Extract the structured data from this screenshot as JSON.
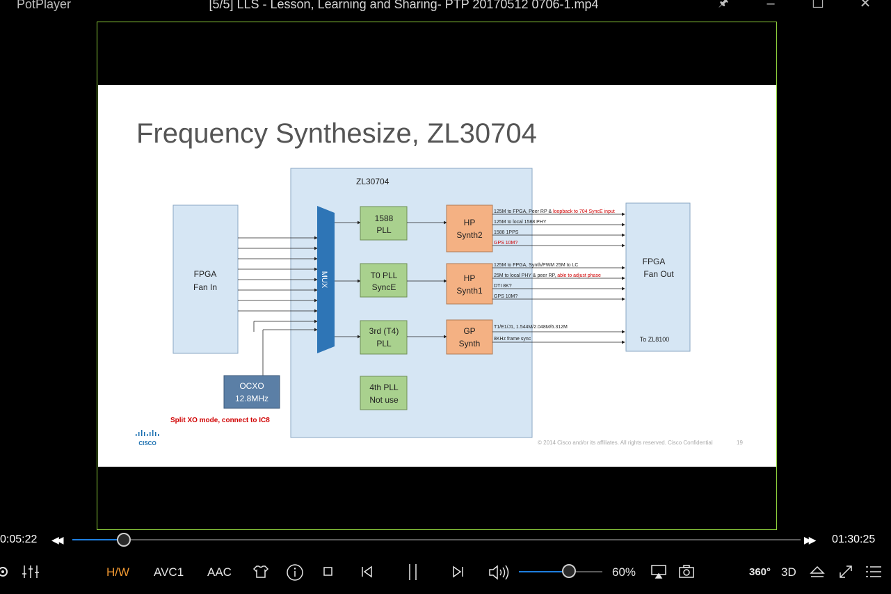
{
  "window": {
    "app_name": "PotPlayer",
    "title": "[5/5] LLS - Lesson, Learning and Sharing- PTP 20170512 0706-1.mp4"
  },
  "slide": {
    "title": "Frequency Synthesize, ZL30704",
    "chip_label": "ZL30704",
    "fpga_in": [
      "FPGA",
      "Fan In"
    ],
    "fpga_out": [
      "FPGA",
      "Fan Out"
    ],
    "fpga_out_note": "To ZL8100",
    "mux": "MUX",
    "ocxo": [
      "OCXO",
      "12.8MHz"
    ],
    "split_note": "Split XO mode, connect to IC8",
    "plls": [
      {
        "line1": "1588",
        "line2": "PLL"
      },
      {
        "line1": "T0 PLL",
        "line2": "SyncE"
      },
      {
        "line1": "3rd (T4)",
        "line2": "PLL"
      },
      {
        "line1": "4th PLL",
        "line2": "Not use"
      }
    ],
    "synths": [
      {
        "line1": "HP",
        "line2": "Synth2"
      },
      {
        "line1": "HP",
        "line2": "Synth1"
      },
      {
        "line1": "GP",
        "line2": "Synth"
      }
    ],
    "outputs": [
      {
        "text": "125M to FPGA, Peer RP & ",
        "red": "loopback to 704 SyncE input"
      },
      {
        "text": "125M to local 1588 PHY",
        "red": ""
      },
      {
        "text": "1588 1PPS",
        "red": ""
      },
      {
        "text": "",
        "red": "GPS 10M?"
      },
      {
        "text": "125M to FPGA, Synth/PWM 25M to LC",
        "red": ""
      },
      {
        "text": "25M to local PHY & peer RP, ",
        "red": "able to adjust phase"
      },
      {
        "text": "DTI 8K?",
        "red": ""
      },
      {
        "text": "GPS 10M?",
        "red": ""
      },
      {
        "text": "T1/E1/J1, 1.544M/2.048M/6.312M",
        "red": ""
      },
      {
        "text": "8KHz frame sync",
        "red": ""
      }
    ],
    "logo_text": "CISCO",
    "copyright": "© 2014  Cisco and/or its affiliates. All rights reserved.   Cisco Confidential",
    "page_number": "19"
  },
  "playback": {
    "current_time": "0:05:22",
    "total_time": "01:30:25",
    "progress_fraction": 0.0709,
    "volume_label": "60%",
    "volume_fraction": 0.6
  },
  "controls": {
    "hw_label": "H/W",
    "video_codec": "AVC1",
    "audio_codec": "AAC",
    "vr_label": "360°",
    "three_d_label": "3D"
  },
  "colors": {
    "accent": "#1e7fe0",
    "hw_active": "#f39a32",
    "frame_border": "#8fd13c"
  }
}
